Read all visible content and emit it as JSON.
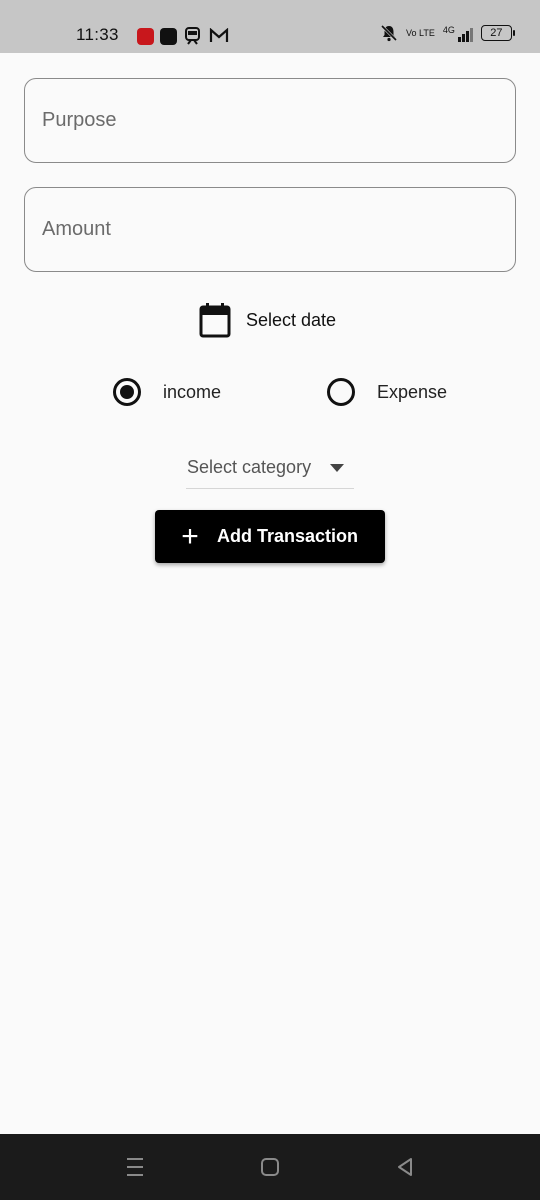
{
  "status_bar": {
    "time": "11:33",
    "network": "4G",
    "volte": "Vo LTE",
    "battery": "27"
  },
  "form": {
    "purpose_placeholder": "Purpose",
    "amount_placeholder": "Amount",
    "date_label": "Select date",
    "radio_income_label": "income",
    "radio_expense_label": "Expense",
    "selected_type": "income",
    "category_label": "Select category",
    "submit_label": "Add Transaction"
  },
  "icons": {
    "date": "calendar-icon",
    "submit": "plus-icon"
  },
  "colors": {
    "accent": "#000000",
    "background": "#fafafa",
    "status_bar": "#c6c6c6",
    "nav_bar": "#1b1b1b"
  }
}
